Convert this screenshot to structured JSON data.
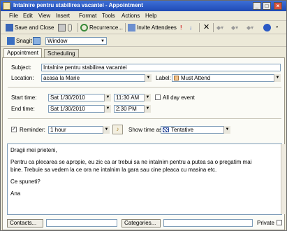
{
  "window": {
    "title": "Intalnire pentru stabilirea vacantei - Appointment"
  },
  "menu": [
    "File",
    "Edit",
    "View",
    "Insert",
    "Format",
    "Tools",
    "Actions",
    "Help"
  ],
  "toolbar": {
    "save_close": "Save and Close",
    "recurrence": "Recurrence...",
    "invite": "Invite Attendees"
  },
  "snagit": {
    "label": "Snagit",
    "window_option": "Window"
  },
  "tabs": [
    "Appointment",
    "Scheduling"
  ],
  "form": {
    "subject_label": "Subject:",
    "subject_value": "Intalnire pentru stabilirea vacantei",
    "location_label": "Location:",
    "location_value": "acasa la Marie",
    "label_label": "Label:",
    "label_value": "Must Attend",
    "start_label": "Start time:",
    "start_date": "Sat 1/30/2010",
    "start_time": "11:30 AM",
    "allday_label": "All day event",
    "end_label": "End time:",
    "end_date": "Sat 1/30/2010",
    "end_time": "2:30 PM",
    "reminder_label": "Reminder:",
    "reminder_value": "1 hour",
    "showas_label": "Show time as:",
    "showas_value": "Tentative"
  },
  "body": {
    "line1": "Dragii mei prieteni,",
    "line2": "Pentru ca plecarea se apropie, eu zic ca ar trebui sa ne intalnim pentru a putea sa o pregatim mai",
    "line3": "bine. Trebuie sa vedem la ce ora ne intalnim la gara sau cine pleaca cu masina etc.",
    "line4": "Ce spuneti?",
    "line5": "Ana"
  },
  "footer": {
    "contacts": "Contacts...",
    "categories": "Categories...",
    "private": "Private"
  },
  "colors": {
    "title_bar": "#2a59c5",
    "label_swatch": "#f2c28a"
  }
}
